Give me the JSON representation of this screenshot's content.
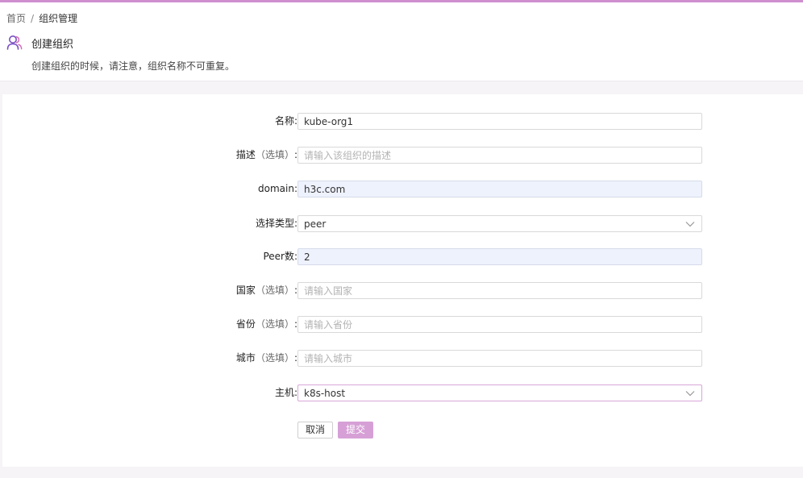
{
  "breadcrumb": {
    "home": "首页",
    "separator": "/",
    "current": "组织管理"
  },
  "header": {
    "icon": "user-group-icon",
    "title": "创建组织",
    "description": "创建组织的时候，请注意，组织名称不可重复。"
  },
  "form": {
    "name": {
      "label": "名称:",
      "value": "kube-org1"
    },
    "description": {
      "label": "描述",
      "optional": "（选填）",
      "colon": ":",
      "placeholder": "请输入该组织的描述"
    },
    "domain": {
      "label": "domain:",
      "value": "h3c.com"
    },
    "type": {
      "label": "选择类型:",
      "selected": "peer"
    },
    "peer_count": {
      "label": "Peer数:",
      "value": "2"
    },
    "country": {
      "label": "国家",
      "optional": "（选填）",
      "colon": ":",
      "placeholder": "请输入国家"
    },
    "province": {
      "label": "省份",
      "optional": "（选填）",
      "colon": ":",
      "placeholder": "请输入省份"
    },
    "city": {
      "label": "城市",
      "optional": "（选填）",
      "colon": ":",
      "placeholder": "请输入城市"
    },
    "host": {
      "label": "主机:",
      "selected": "k8s-host"
    }
  },
  "buttons": {
    "cancel": "取消",
    "submit": "提交"
  },
  "colors": {
    "accent": "#cf8fcf",
    "submit_bg": "#d6a0d6",
    "filled_input_bg": "#eef2fd",
    "icon_purple": "#7a4fc4"
  }
}
